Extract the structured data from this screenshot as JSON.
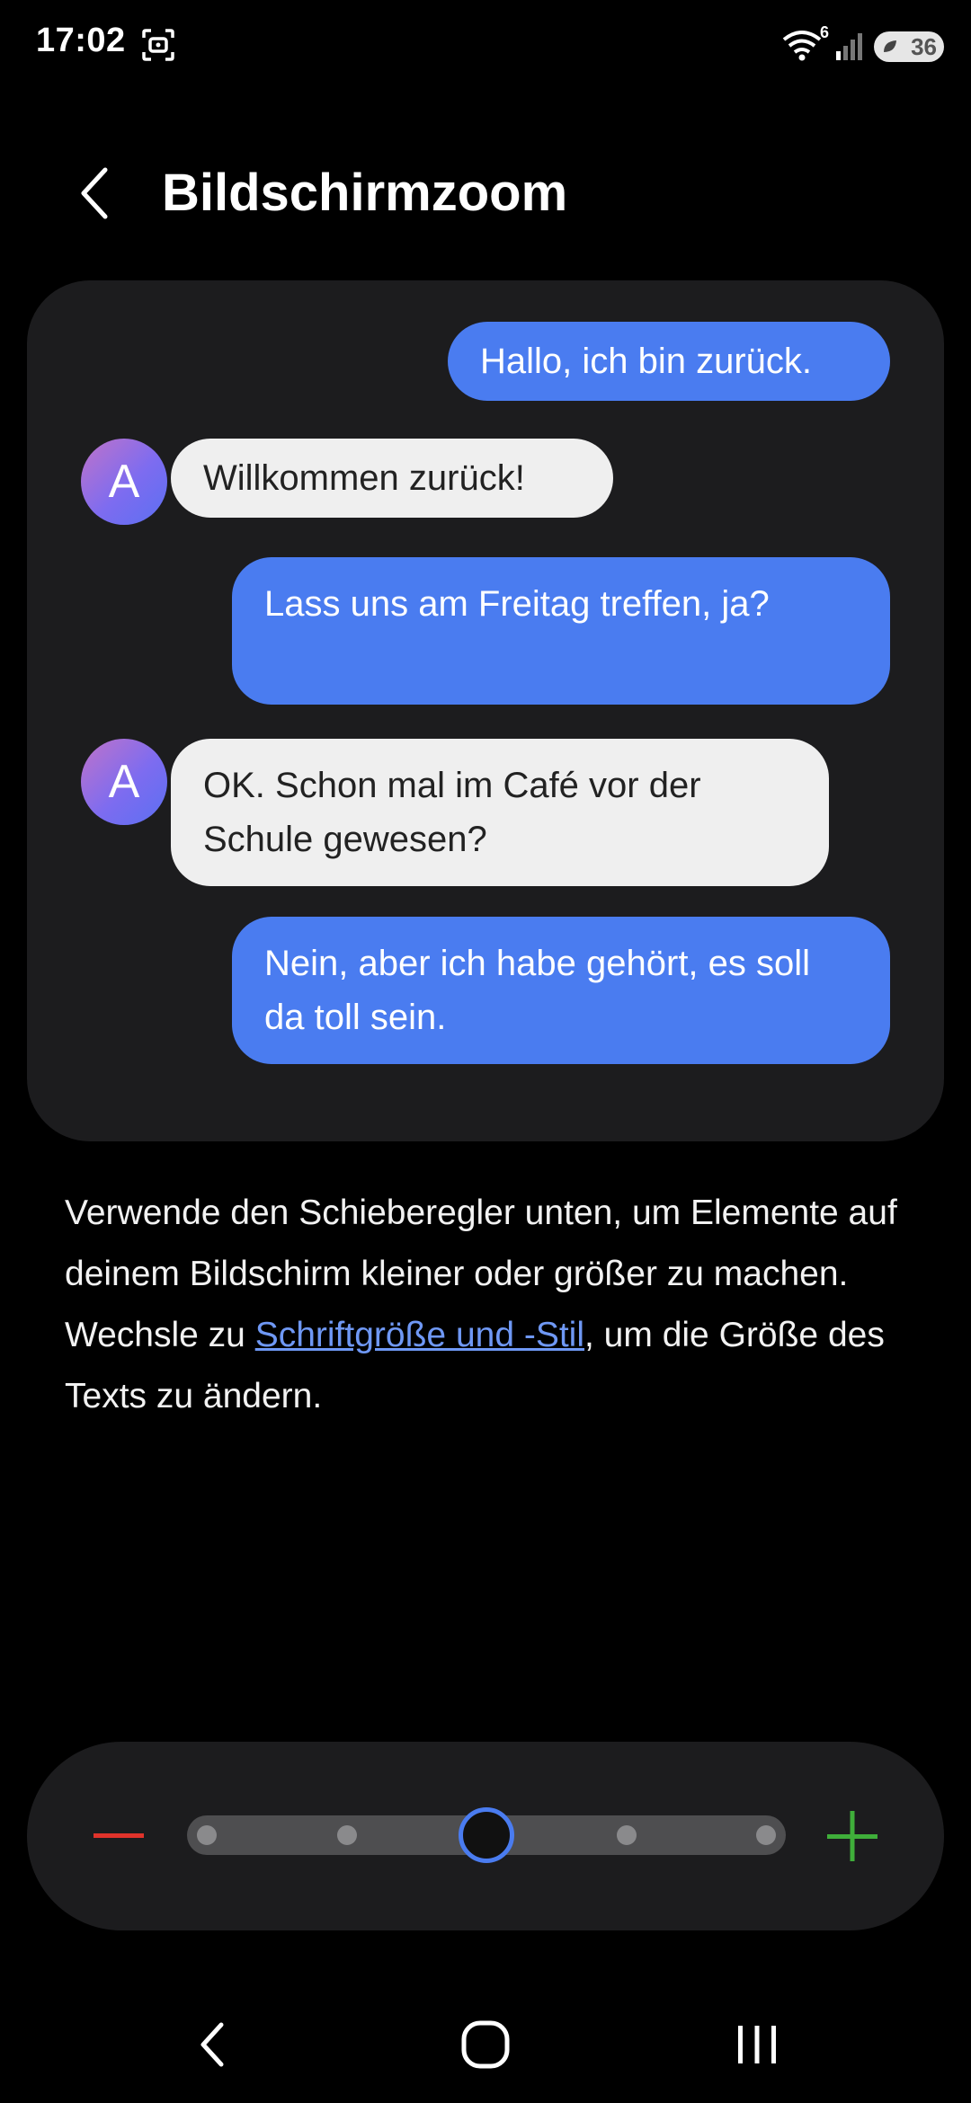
{
  "status_bar": {
    "time": "17:02",
    "wifi_label": "6",
    "battery_level": "36"
  },
  "header": {
    "title": "Bildschirmzoom"
  },
  "preview": {
    "messages": [
      {
        "type": "outgoing",
        "text": "Hallo, ich bin zurück."
      },
      {
        "type": "incoming",
        "avatar": "A",
        "text": "Willkommen zurück!"
      },
      {
        "type": "outgoing",
        "text": "Lass uns am Freitag treffen, ja?"
      },
      {
        "type": "incoming",
        "avatar": "A",
        "text": "OK. Schon mal im Café vor der Schule gewesen?"
      },
      {
        "type": "outgoing",
        "text": "Nein, aber ich habe gehört, es soll da toll sein."
      }
    ]
  },
  "description": {
    "part1": "Verwende den Schieberegler unten, um Elemente auf deinem Bildschirm kleiner oder größer zu machen. Wechsle zu ",
    "link": "Schriftgröße und -Stil",
    "part2": ", um die Größe des Texts zu ändern."
  },
  "slider": {
    "steps": 5,
    "selected_step": 3,
    "minus_color": "#e0332b",
    "plus_color": "#3fae3a",
    "accent_color": "#4a7cf0"
  },
  "icons": {
    "back": "chevron-left-icon",
    "minus": "minus-icon",
    "plus": "plus-icon",
    "nav_back": "nav-back-icon",
    "nav_home": "nav-home-icon",
    "nav_recents": "nav-recents-icon"
  }
}
